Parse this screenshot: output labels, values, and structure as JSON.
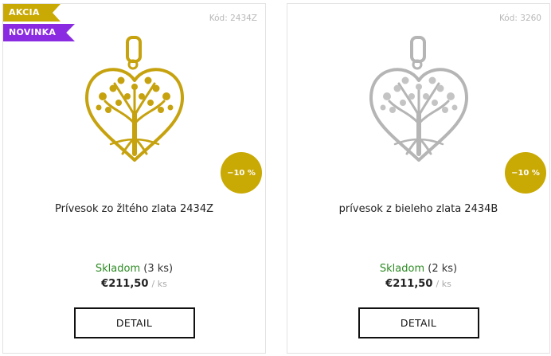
{
  "products": [
    {
      "code": "Kód: 2434Z",
      "badges": {
        "akcia": "AKCIA",
        "novinka": "NOVINKA"
      },
      "discount": "−10 %",
      "name": "Prívesok zo žltého zlata 2434Z",
      "stock_label": "Skladom",
      "stock_count": "(3 ks)",
      "price": "€211,50",
      "unit": "/ ks",
      "detail_label": "DETAIL",
      "image_icon": "gold-heart-tree-pendant",
      "metal_color": "#c6a20e"
    },
    {
      "code": "Kód: 3260",
      "discount": "−10 %",
      "name": "prívesok z bieleho zlata 2434B",
      "stock_label": "Skladom",
      "stock_count": "(2 ks)",
      "price": "€211,50",
      "unit": "/ ks",
      "detail_label": "DETAIL",
      "image_icon": "white-gold-heart-tree-pendant",
      "metal_color": "#b8b8b8"
    }
  ],
  "colors": {
    "accent_gold": "#c9a904",
    "badge_purple": "#8a2be2",
    "stock_green": "#2e8b24"
  }
}
